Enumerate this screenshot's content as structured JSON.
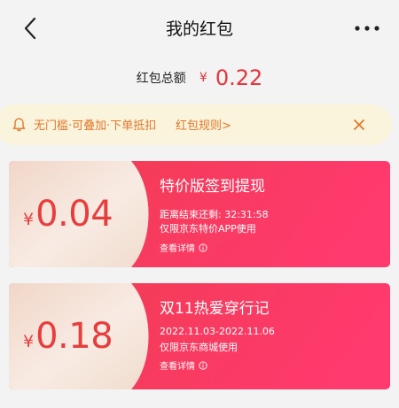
{
  "header": {
    "title": "我的红包"
  },
  "summary": {
    "label": "红包总额",
    "currency": "¥",
    "amount": "0.22"
  },
  "notice": {
    "text": "无门槛·可叠加·下单抵扣",
    "rules_link": "红包规则>"
  },
  "cards": [
    {
      "currency": "¥",
      "amount": "0.04",
      "name": "特价版签到提现",
      "line1": "距离结束还剩: 32:31:58",
      "line2": "仅限京东特价APP使用",
      "detail": "查看详情"
    },
    {
      "currency": "¥",
      "amount": "0.18",
      "name": "双11热爱穿行记",
      "line1": "2022.11.03-2022.11.06",
      "line2": "仅限京东商城使用",
      "detail": "查看详情"
    }
  ],
  "colors": {
    "accent_red": "#e8333a",
    "notice_bg": "#fbf4dc",
    "notice_text": "#e0772a",
    "card_gradient": [
      "#f0424a",
      "#ff3a6e"
    ],
    "card_left": "#f5e2d6"
  },
  "icons": [
    "back-arrow-icon",
    "more-dots-icon",
    "bell-icon",
    "close-icon",
    "info-icon"
  ]
}
